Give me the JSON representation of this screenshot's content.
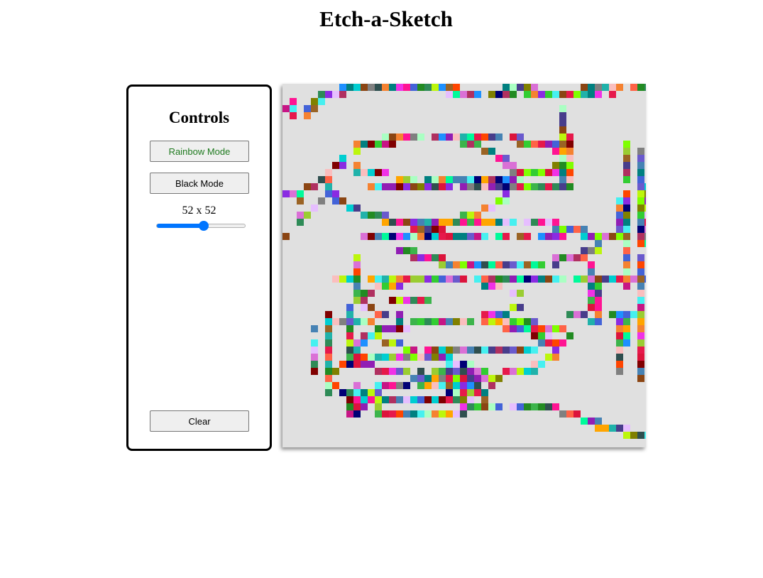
{
  "page": {
    "title": "Etch-a-Sketch"
  },
  "controls": {
    "title": "Controls",
    "rainbow_label": "Rainbow Mode",
    "black_label": "Black Mode",
    "size_label": "52 x 52",
    "clear_label": "Clear"
  },
  "grid": {
    "size": 52,
    "background_color": "#e0e0e0",
    "slider_fraction": 0.52
  },
  "colors": {
    "slider_accent": "#0075ff",
    "rainbow_label_color": "#1f7a1f",
    "palette": [
      "#e6194b",
      "#3cb44b",
      "#4363d8",
      "#f58231",
      "#911eb4",
      "#46f0f0",
      "#f032e6",
      "#bcf60c",
      "#fabebe",
      "#008080",
      "#e6beff",
      "#9a6324",
      "#800000",
      "#aaffc3",
      "#808000",
      "#000075",
      "#808080",
      "#2e8b57",
      "#8a2be2",
      "#ff1493",
      "#00ced1",
      "#ffa500",
      "#1e90ff",
      "#32cd32",
      "#dc143c",
      "#6a5acd",
      "#20b2aa",
      "#ff6347",
      "#7fff00",
      "#b03060",
      "#483d8b",
      "#2f4f4f",
      "#9acd32",
      "#c71585",
      "#00fa9a",
      "#8b4513",
      "#4682b4",
      "#da70d6",
      "#228b22",
      "#ff4500"
    ]
  }
}
